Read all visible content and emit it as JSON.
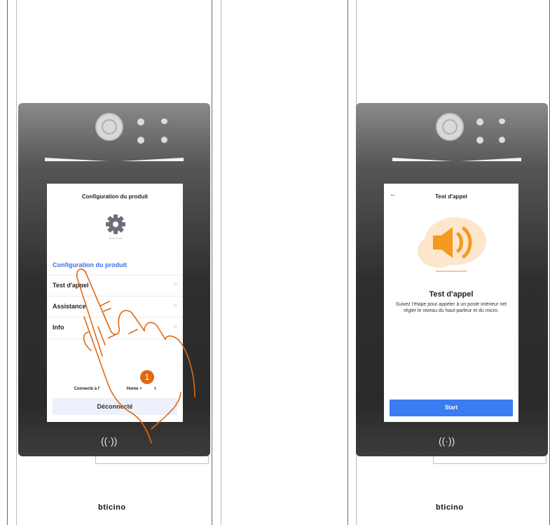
{
  "left_panel": {
    "screen_title": "Configuration du produit",
    "section_title": "Configuration du produit",
    "menu": [
      {
        "label": "Test d'appel",
        "chevron": ">"
      },
      {
        "label": "Assistance",
        "chevron": ">"
      },
      {
        "label": "Info",
        "chevron": ">"
      }
    ],
    "connection_prefix": "Connecté à l'",
    "connection_suffix": "Home + ",
    "connection_tail": "t",
    "logout_label": "Déconnecté",
    "step_badge": "1",
    "nfc_symbol": "((·))",
    "brand": "bticino"
  },
  "right_panel": {
    "back_arrow": "←",
    "screen_title": "Test d'appel",
    "heading": "Test d'appel",
    "description": "Suivez l'étape pour appeler à un poste intérieur net régler le niveau du haut-parleur et du micro.",
    "start_label": "Start",
    "nfc_symbol": "((·))",
    "brand": "bticino"
  },
  "colors": {
    "accent_blue": "#3b6fe8",
    "start_button": "#3b7cf3",
    "hand_stroke": "#e06a12",
    "speaker_orange": "#f39a1f"
  },
  "icons": [
    "gear-icon",
    "speaker-icon",
    "back-arrow-icon",
    "chevron-right-icon",
    "nfc-icon",
    "hand-pointer-icon"
  ]
}
